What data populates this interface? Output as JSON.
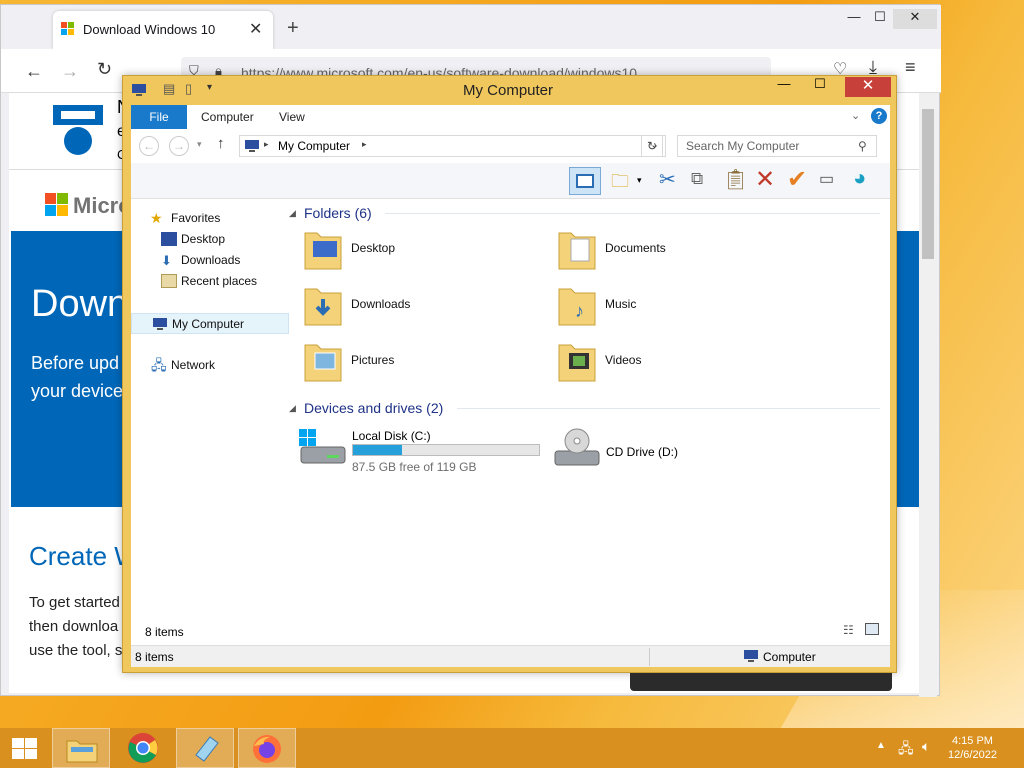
{
  "browser": {
    "tab_title": "Download Windows 10",
    "tab_close": "✕",
    "new_tab": "+",
    "url": "https://www.microsoft.com/en-us/software-download/windows10",
    "window_min": "—",
    "window_max": "☐",
    "window_close": "✕"
  },
  "page": {
    "partial_header_letters": [
      "N",
      "e",
      "C"
    ],
    "ms_partial": "Micro",
    "hero_title": "Down",
    "hero_line1": "Before upd",
    "hero_line2": "your device",
    "create_heading": "Create W",
    "body_line1": "To get started",
    "body_line2": "then downloa",
    "body_line3": "use the tool, s"
  },
  "explorer": {
    "title": "My Computer",
    "ribbon_tabs": [
      "File",
      "Computer",
      "View"
    ],
    "address": "My Computer",
    "search_placeholder": "Search My Computer",
    "nav": {
      "favorites": "Favorites",
      "desktop": "Desktop",
      "downloads": "Downloads",
      "recent": "Recent places",
      "my_computer": "My Computer",
      "network": "Network"
    },
    "folders_header": "Folders (6)",
    "folders": [
      "Desktop",
      "Documents",
      "Downloads",
      "Music",
      "Pictures",
      "Videos"
    ],
    "devices_header": "Devices and drives (2)",
    "local_disk": {
      "name": "Local Disk (C:)",
      "free_text": "87.5 GB free of 119 GB",
      "used_fraction": 0.265
    },
    "cd_drive": "CD Drive (D:)",
    "items_count": "8 items",
    "status_items": "8 items",
    "status_location": "Computer"
  },
  "taskbar": {
    "time": "4:15 PM",
    "date": "12/6/2022"
  },
  "colors": {
    "accent_blue": "#0067b8",
    "file_tab": "#1979ca",
    "explorer_frame": "#f0c75c",
    "close_red": "#c7413a",
    "taskbar": "#d9901e"
  }
}
